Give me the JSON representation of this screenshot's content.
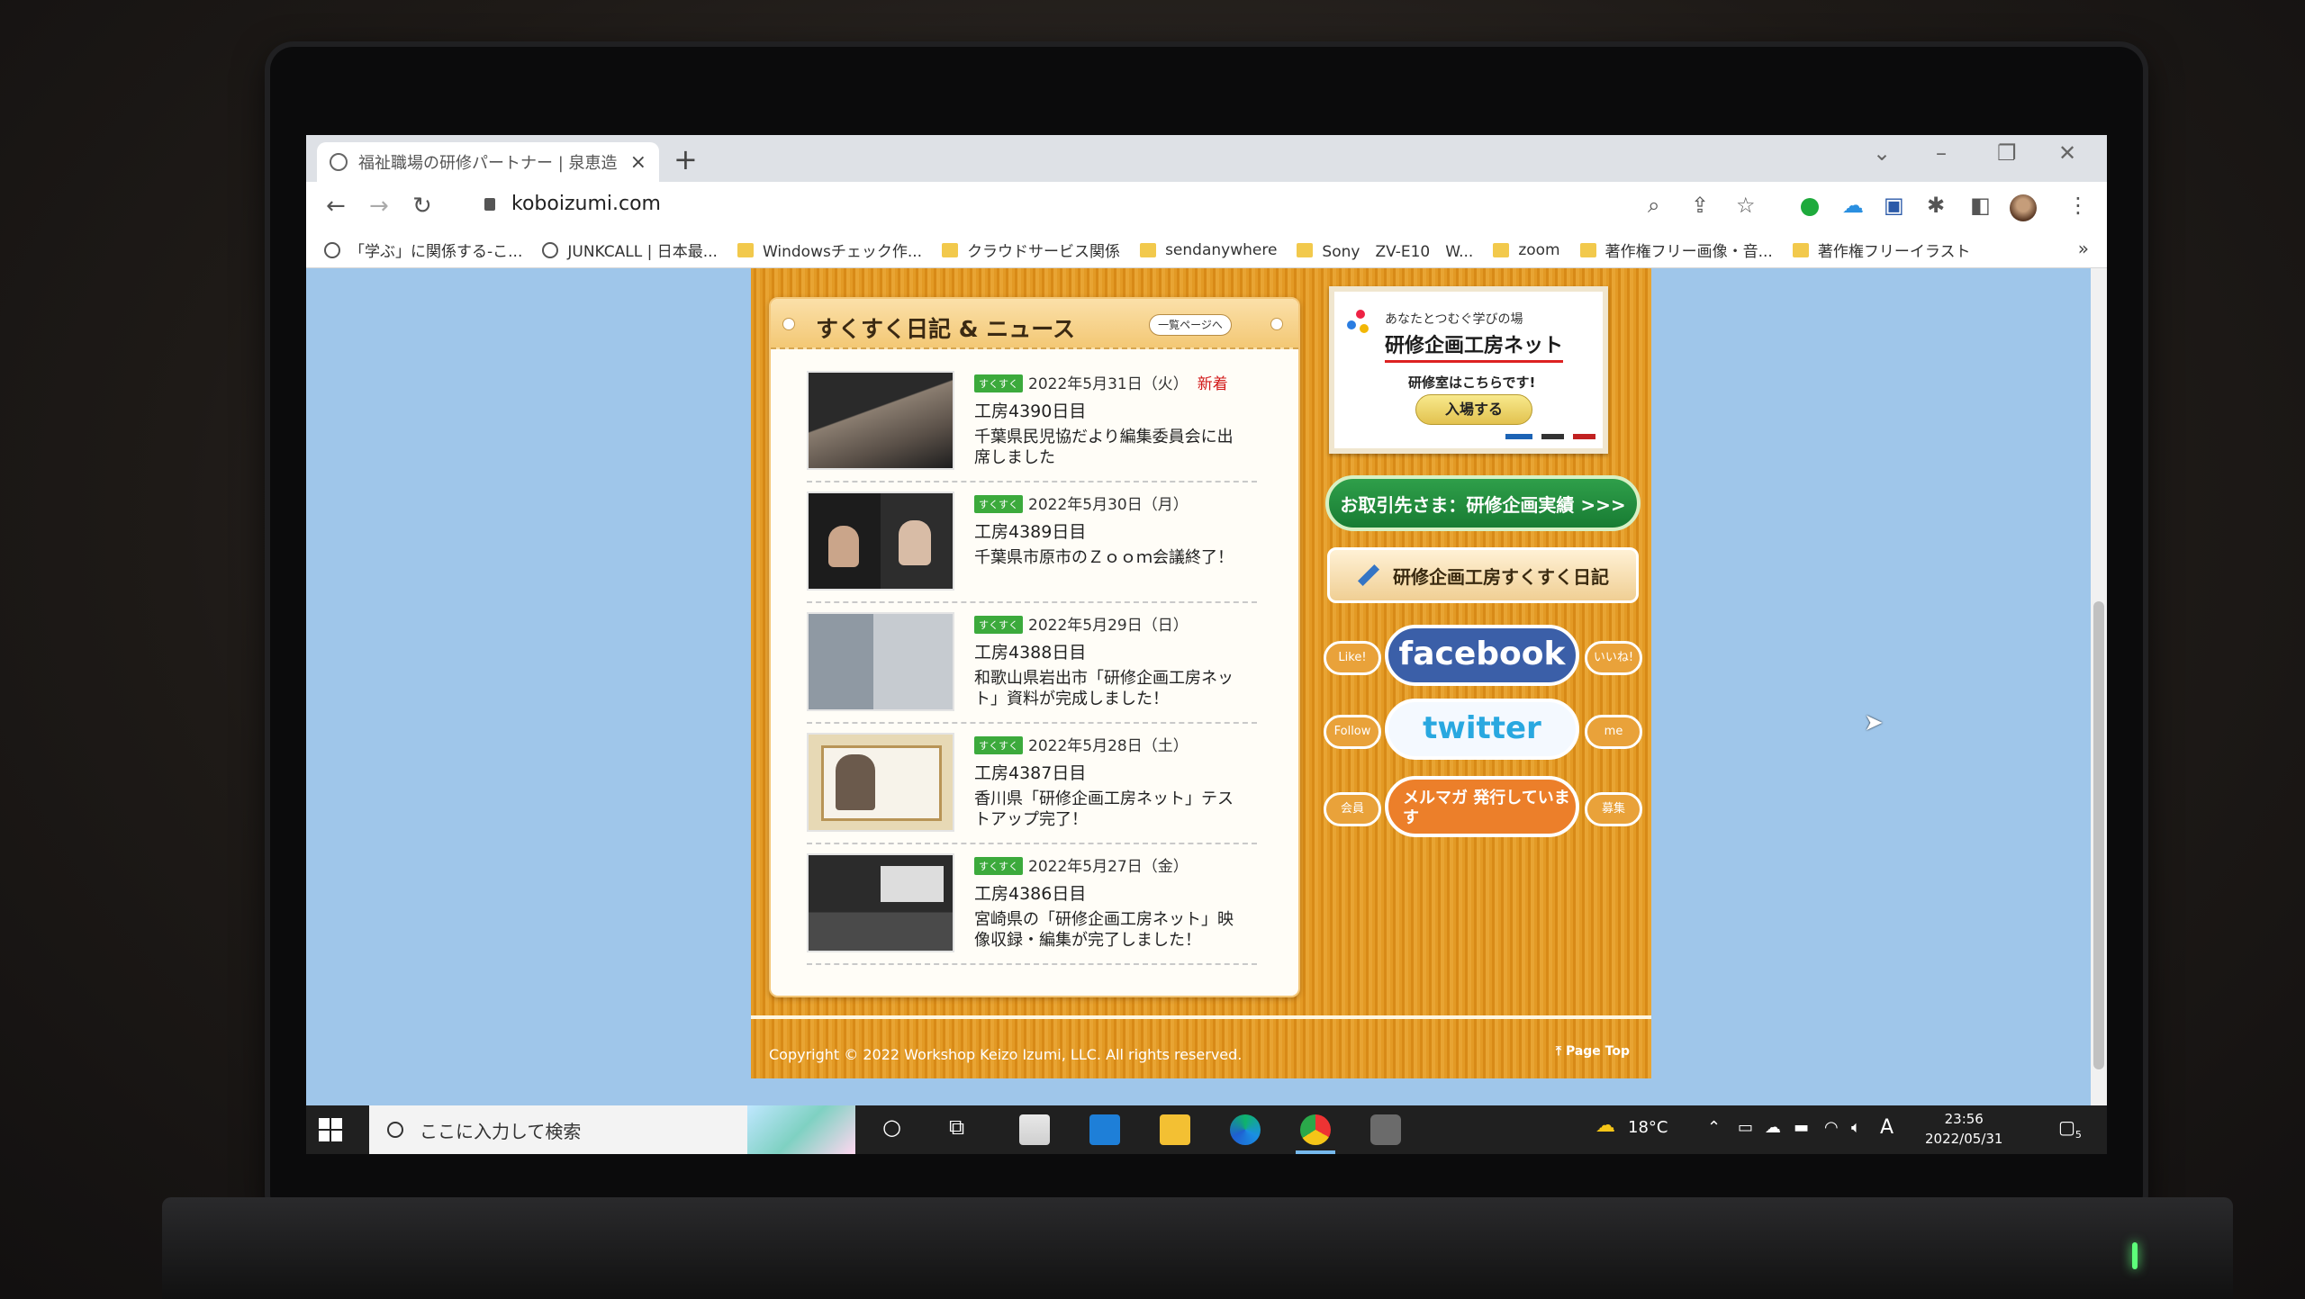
{
  "browser": {
    "tab_title": "福祉職場の研修パートナー | 泉恵造",
    "tab_close": "×",
    "new_tab": "+",
    "url": "koboizumi.com",
    "bookmarks": [
      {
        "label": "「学ぶ」に関係する-こ...",
        "icon": "globe-icon"
      },
      {
        "label": "JUNKCALL | 日本最...",
        "icon": "junkcall-icon"
      },
      {
        "label": "Windowsチェック作...",
        "icon": "folder-icon"
      },
      {
        "label": "クラウドサービス関係",
        "icon": "folder-icon"
      },
      {
        "label": "sendanywhere",
        "icon": "folder-icon"
      },
      {
        "label": "Sony　ZV-E10　W...",
        "icon": "folder-icon"
      },
      {
        "label": "zoom",
        "icon": "folder-icon"
      },
      {
        "label": "著作権フリー画像・音...",
        "icon": "folder-icon"
      },
      {
        "label": "著作権フリーイラスト",
        "icon": "folder-icon"
      }
    ],
    "bookmarks_more": "»"
  },
  "news": {
    "title": "すくすく日記 & ニュース",
    "more_button": "一覧ページへ",
    "tag": "すくすく",
    "entries": [
      {
        "date": "2022年5月31日（火）",
        "badge": "新着",
        "day": "工房4390日目",
        "text": "千葉県民児協だより編集委員会に出席しました"
      },
      {
        "date": "2022年5月30日（月）",
        "badge": "",
        "day": "工房4389日目",
        "text": "千葉県市原市のＺｏｏｍ会議終了！"
      },
      {
        "date": "2022年5月29日（日）",
        "badge": "",
        "day": "工房4388日目",
        "text": "和歌山県岩出市「研修企画工房ネット」資料が完成しました！"
      },
      {
        "date": "2022年5月28日（土）",
        "badge": "",
        "day": "工房4387日目",
        "text": "香川県「研修企画工房ネット」テストアップ完了！"
      },
      {
        "date": "2022年5月27日（金）",
        "badge": "",
        "day": "工房4386日目",
        "text": "宮崎県の「研修企画工房ネット」映像収録・編集が完了しました！"
      }
    ]
  },
  "side": {
    "promo_sub": "あなたとつむぐ学びの場",
    "promo_main": "研修企画工房ネット",
    "promo_cta": "研修室はこちらです!",
    "promo_enter": "入場する",
    "results_button": "お取引先さま：研修企画実績 >>>",
    "diary_button": "研修企画工房すくすく日記",
    "facebook": {
      "left": "Like!",
      "main": "facebook",
      "right": "いいね!"
    },
    "twitter": {
      "left": "Follow",
      "main": "twitter",
      "right": "me"
    },
    "mailmag": {
      "left": "会員",
      "main": "メルマガ 発行しています",
      "right": "募集"
    }
  },
  "footer": {
    "copyright": "Copyright © 2022 Workshop Keizo Izumi, LLC. All rights reserved.",
    "page_top": "Page Top"
  },
  "taskbar": {
    "search_placeholder": "ここに入力して検索",
    "weather": "18°C",
    "ime": "A",
    "time": "23:56",
    "date": "2022/05/31",
    "notifications": "5"
  },
  "colors": {
    "page_bg": "#9fc6ea",
    "wood": "#e39a25",
    "tag_green": "#3caa3c",
    "new_red": "#d21a1a",
    "facebook_blue": "#3b5fa8",
    "twitter_blue": "#29a8e0"
  }
}
